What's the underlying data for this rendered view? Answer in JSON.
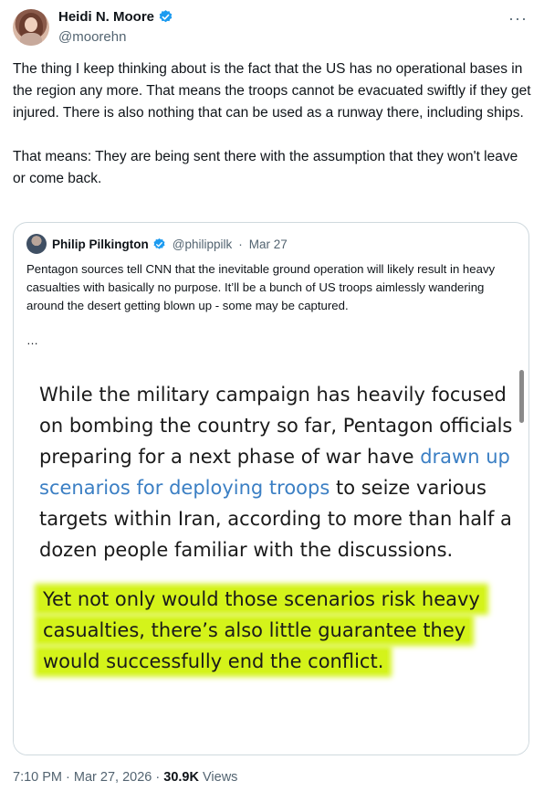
{
  "author": {
    "name": "Heidi N. Moore",
    "handle": "@moorehn"
  },
  "more_icon": "more-dots-icon",
  "verified_color": "#1d9bf0",
  "tweet": {
    "paragraph1": "The thing I keep thinking about is the fact that the US has no operational bases in the region any more. That means the troops cannot be evacuated swiftly if they get injured. There is also nothing that can be used as a runway there, including ships.",
    "paragraph2": "That means: They are being sent there with the assumption that they won't leave or come back."
  },
  "quote": {
    "name": "Philip Pilkington",
    "handle": "@philippilk",
    "separator": "·",
    "date": "Mar 27",
    "text": "Pentagon sources tell CNN that the inevitable ground operation will likely result in heavy casualties with basically no purpose. It’ll be a bunch of US troops aimlessly wandering around the desert getting blown up - some may be captured.",
    "ellipsis": "…",
    "image": {
      "para1_before": "While the military campaign has heavily focused on bombing the country so far, Pentagon officials preparing for a next phase of war have ",
      "para1_link": "drawn up scenarios for deploying troops",
      "para1_after": " to seize various targets within Iran, according to more than half a dozen people familiar with the discussions.",
      "para2_highlighted": "Yet not only would those scenarios risk heavy casualties, there’s also little guarantee they would successfully end the conflict.",
      "highlight_color": "#d4f31a",
      "link_color": "#3b7fc4"
    }
  },
  "footer": {
    "time": "7:10 PM",
    "sep1": "·",
    "date": "Mar 27, 2026",
    "sep2": "·",
    "views_count": "30.9K",
    "views_label": "Views"
  }
}
